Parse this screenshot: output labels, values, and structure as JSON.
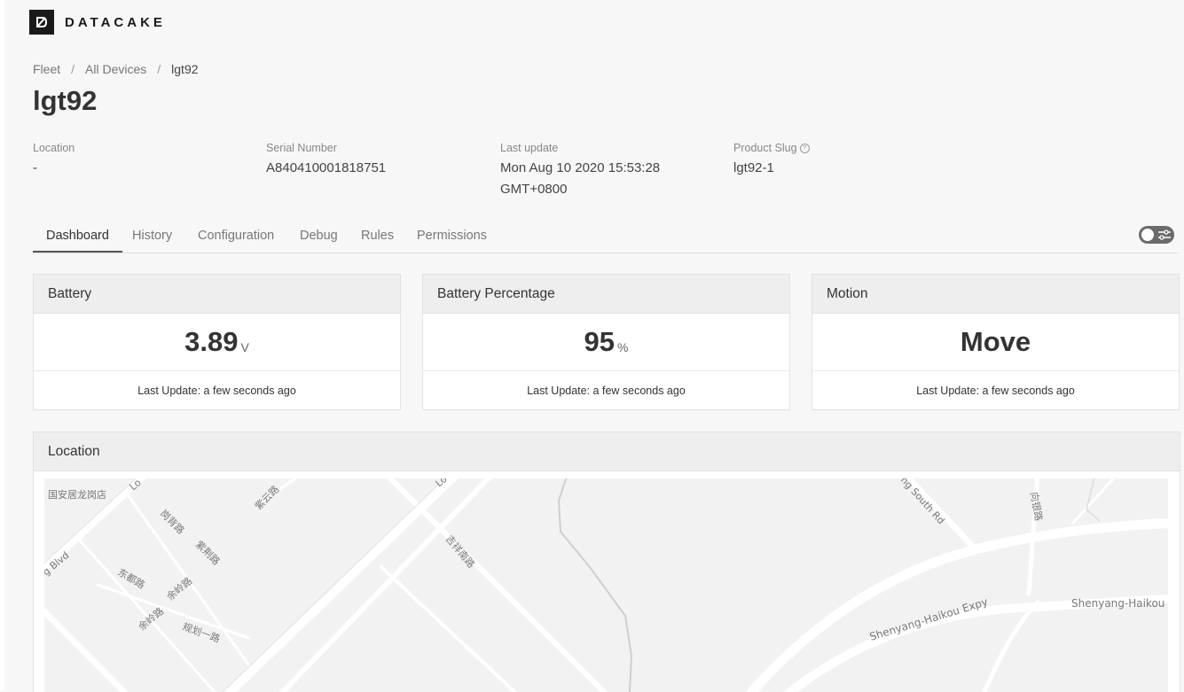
{
  "brand": {
    "name": "DATACAKE"
  },
  "breadcrumb": [
    "Fleet",
    "All Devices",
    "lgt92"
  ],
  "device": {
    "title": "lgt92"
  },
  "meta": [
    {
      "label": "Location",
      "value": "-"
    },
    {
      "label": "Serial Number",
      "value": "A840410001818751"
    },
    {
      "label": "Last update",
      "value": "Mon Aug 10 2020 15:53:28 GMT+0800"
    },
    {
      "label": "Product Slug",
      "value": "lgt92-1"
    }
  ],
  "tabs": [
    "Dashboard",
    "History",
    "Configuration",
    "Debug",
    "Rules",
    "Permissions"
  ],
  "active_tab": "Dashboard",
  "cards": [
    {
      "title": "Battery",
      "value": "3.89",
      "unit": "V",
      "footer": "Last Update: a few seconds ago"
    },
    {
      "title": "Battery Percentage",
      "value": "95",
      "unit": "%",
      "footer": "Last Update: a few seconds ago"
    },
    {
      "title": "Motion",
      "value": "Move",
      "unit": "",
      "footer": "Last Update: a few seconds ago"
    }
  ],
  "location_panel": {
    "title": "Location",
    "map_labels": {
      "shop": "国安居龙岗店",
      "blvd": "g Blvd",
      "lo1": "Lo",
      "lo2": "Lo",
      "r1": "岗背路",
      "r2": "紫云路",
      "r3": "紫荆路",
      "r4": "东都路",
      "r5": "余岭路",
      "r6": "余岭路",
      "r7": "规划一路",
      "r8": "吉祥南路",
      "r9": "ng South Rd",
      "r10": "向银路",
      "expy1": "Shenyang-Haikou Expy",
      "expy2": "Shenyang-Haikou E"
    }
  },
  "colors": {
    "card_header_bg": "#eeeeee",
    "page_bg": "#f7f7f7",
    "tab_active": "#555555"
  }
}
